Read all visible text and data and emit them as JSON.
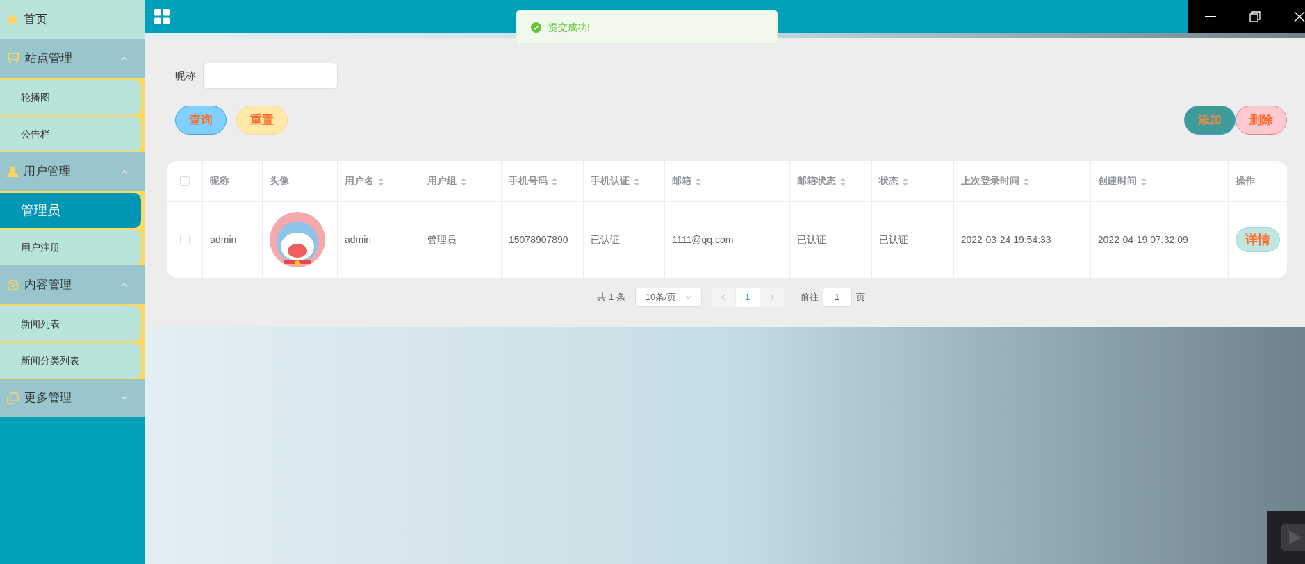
{
  "sidebar": {
    "items": [
      {
        "label": "首页",
        "kind": "link"
      },
      {
        "label": "站点管理",
        "kind": "group",
        "expanded": true,
        "children": [
          {
            "label": "轮播图",
            "selected": false
          },
          {
            "label": "公告栏",
            "selected": false
          }
        ]
      },
      {
        "label": "用户管理",
        "kind": "group",
        "expanded": true,
        "children": [
          {
            "label": "管理员",
            "selected": true
          },
          {
            "label": "用户注册",
            "selected": false
          }
        ]
      },
      {
        "label": "内容管理",
        "kind": "group",
        "expanded": true,
        "children": [
          {
            "label": "新闻列表",
            "selected": false
          },
          {
            "label": "新闻分类列表",
            "selected": false
          }
        ]
      },
      {
        "label": "更多管理",
        "kind": "group",
        "expanded": false
      }
    ]
  },
  "toast": {
    "message": "提交成功!"
  },
  "search": {
    "label": "昵称"
  },
  "buttons": [
    {
      "label": "查询",
      "kind": "query"
    },
    {
      "label": "重置",
      "kind": "reset"
    },
    {
      "label": "添加",
      "kind": "add"
    },
    {
      "label": "删除",
      "kind": "delete"
    }
  ],
  "table": {
    "select_all_checked": false,
    "columns": [
      {
        "label": "昵称",
        "sortable": false
      },
      {
        "label": "头像",
        "sortable": false
      },
      {
        "label": "用户名",
        "sortable": true
      },
      {
        "label": "用户组",
        "sortable": true
      },
      {
        "label": "手机号码",
        "sortable": true
      },
      {
        "label": "手机认证",
        "sortable": true
      },
      {
        "label": "邮箱",
        "sortable": true
      },
      {
        "label": "邮箱状态",
        "sortable": true
      },
      {
        "label": "状态",
        "sortable": true
      },
      {
        "label": "上次登录时间",
        "sortable": true
      },
      {
        "label": "创建时间",
        "sortable": true
      },
      {
        "label": "操作",
        "sortable": false
      }
    ],
    "rows": [
      {
        "checked": false,
        "cells": [
          "admin",
          {
            "kind": "picture"
          },
          "admin",
          "管理员",
          "15078907890",
          "已认证",
          "1111@qq.com",
          "已认证",
          "已认证",
          "2022-03-24 19:54:33",
          "2022-04-19 07:32:09"
        ],
        "action": "详情"
      }
    ]
  },
  "pagination": {
    "total": "共 1 条",
    "page_size": "10条/页",
    "current": "1",
    "goto_label": "前往",
    "goto_value": "1",
    "page_suffix": "页"
  }
}
